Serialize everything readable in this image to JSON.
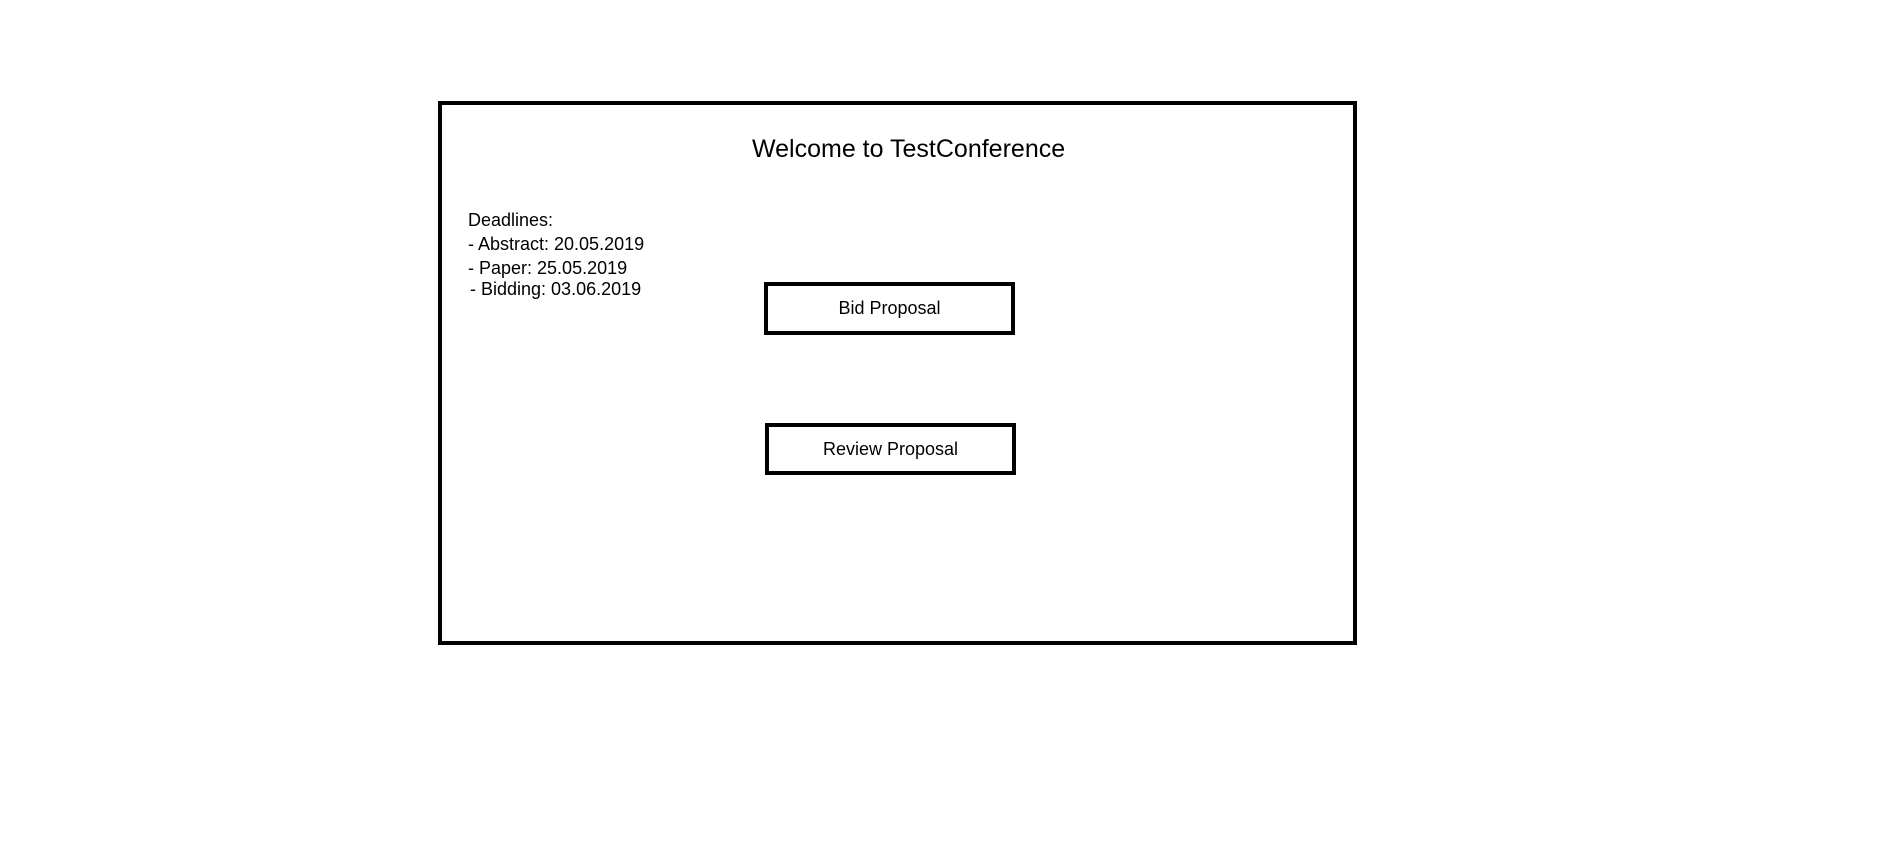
{
  "page": {
    "title": "Welcome to TestConference"
  },
  "deadlines": {
    "heading": "Deadlines:",
    "items": [
      "- Abstract: 20.05.2019",
      "- Paper: 25.05.2019",
      "- Bidding: 03.06.2019"
    ]
  },
  "actions": {
    "bid_label": "Bid Proposal",
    "review_label": "Review Proposal"
  },
  "colors": {
    "background": "#ffffff",
    "border": "#000000",
    "text": "#000000"
  }
}
